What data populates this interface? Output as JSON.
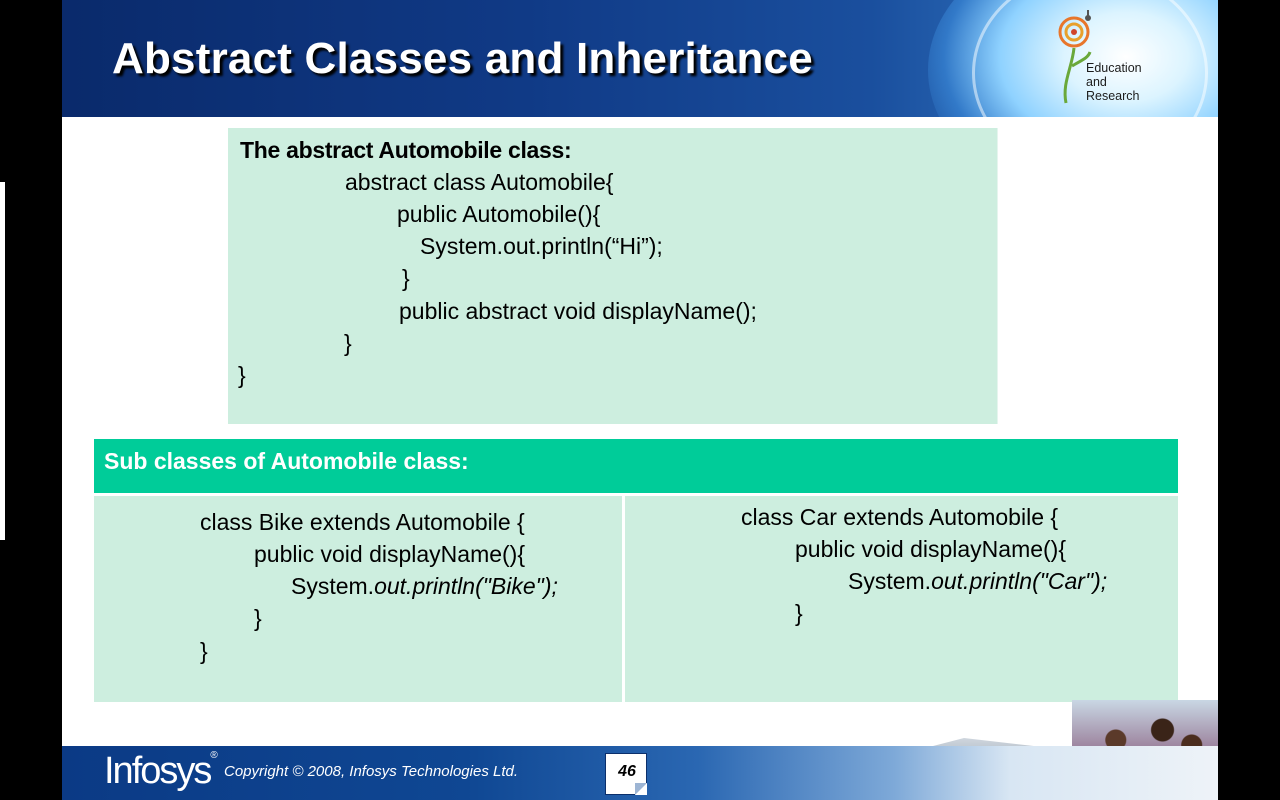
{
  "slide": {
    "title": "Abstract Classes and Inheritance",
    "logo_lines": [
      "Education",
      "and",
      "Research"
    ]
  },
  "abstract_box": {
    "heading": "The abstract Automobile class:",
    "lines": [
      "abstract class Automobile{",
      "public Automobile(){",
      "System.out.println(“Hi”);",
      "}",
      "public abstract void displayName();",
      "}",
      "}"
    ]
  },
  "subclasses": {
    "heading": "Sub classes of Automobile class:",
    "bike": {
      "line1": "class Bike extends Automobile {",
      "line2": "public void displayName(){",
      "line3_prefix": "System.",
      "line3_italic": "out.println(\"Bike\");",
      "line4": "}",
      "line5": "}"
    },
    "car": {
      "line1": "class Car extends Automobile {",
      "line2": "public void displayName(){",
      "line3_prefix": "System.",
      "line3_italic": "out.println(\"Car\");",
      "line4": "}"
    }
  },
  "footer": {
    "brand": "Infosys",
    "registered": "®",
    "copyright": "Copyright © 2008, Infosys Technologies Ltd.",
    "page_number": "46"
  }
}
